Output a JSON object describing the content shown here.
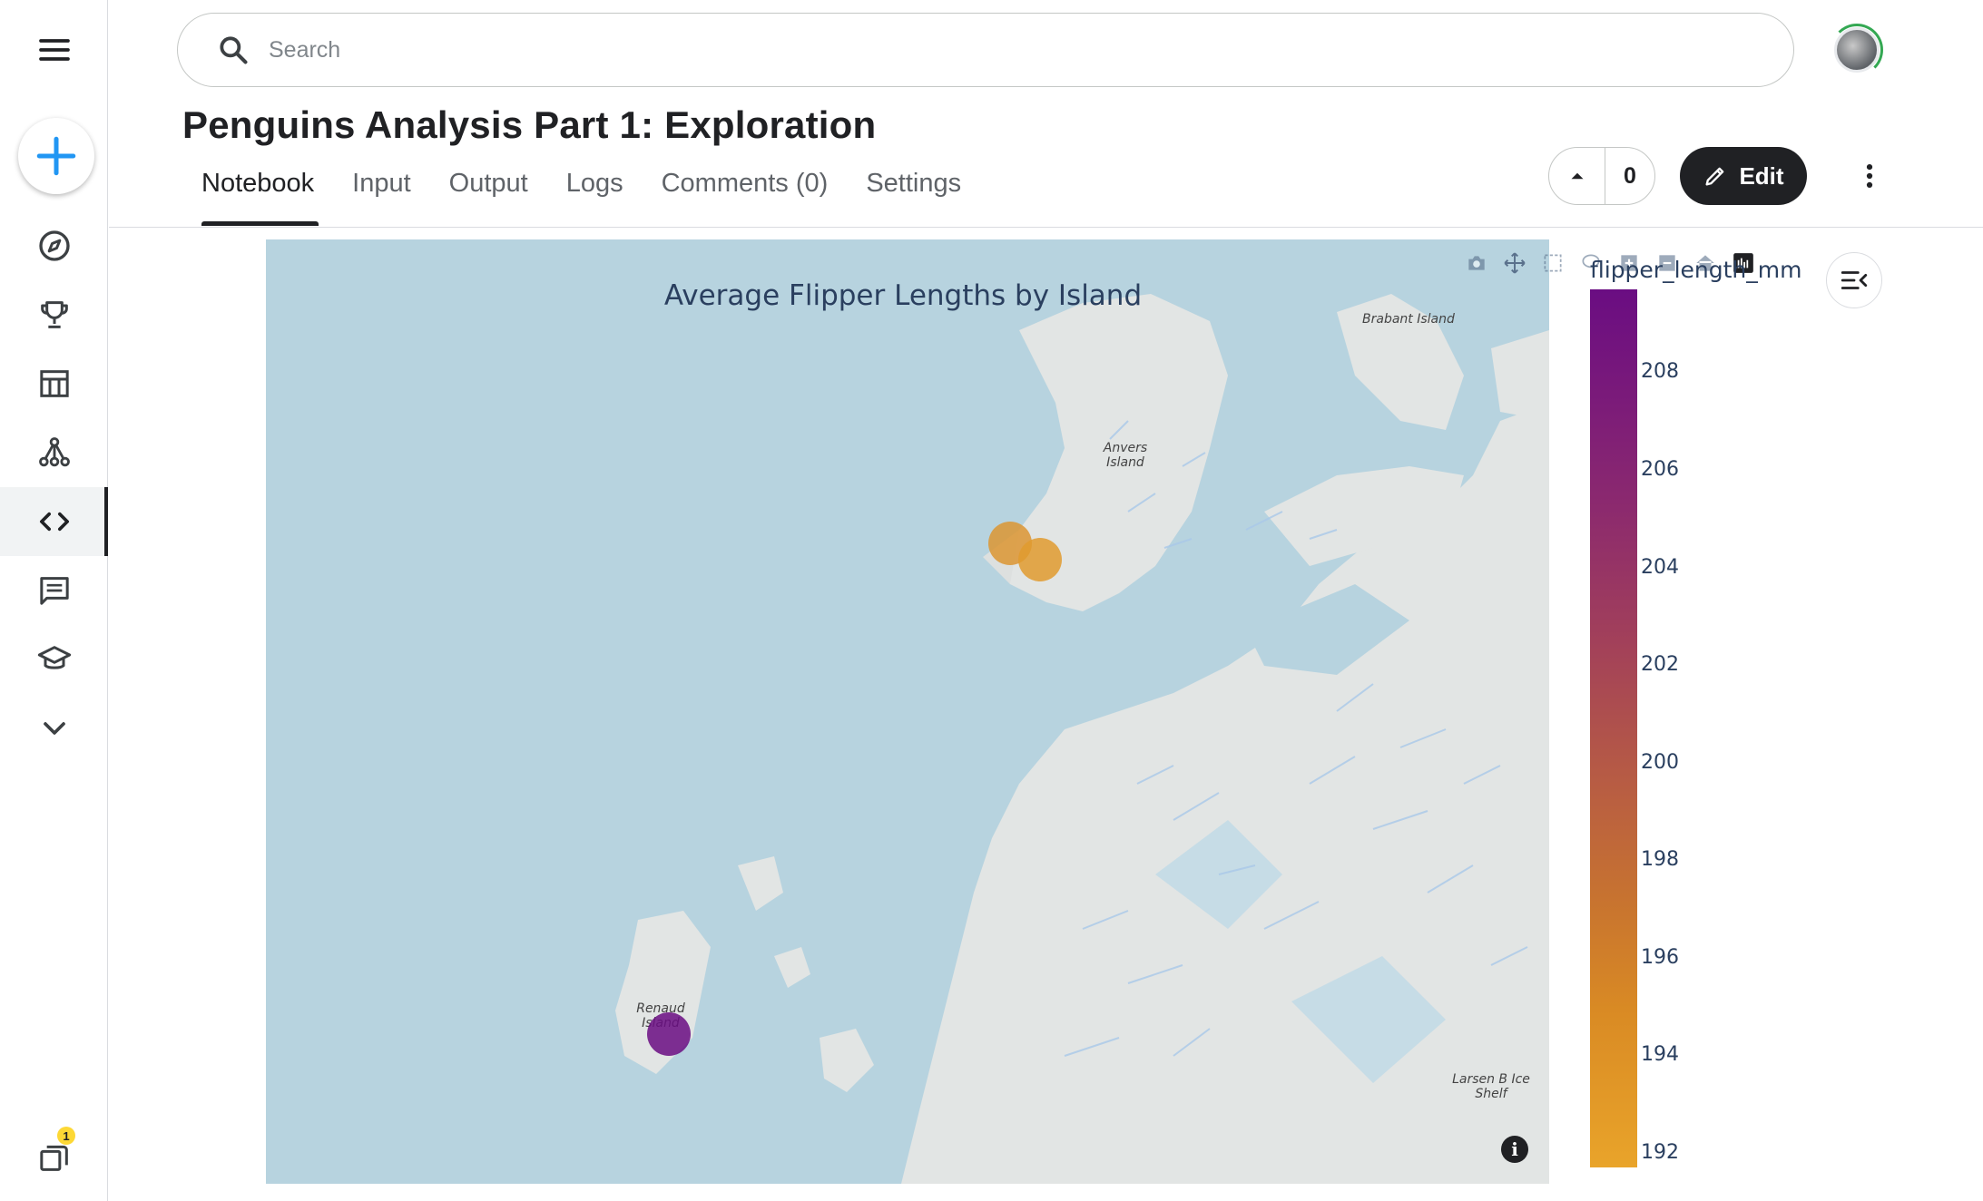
{
  "header": {
    "search_placeholder": "Search",
    "title": "Penguins Analysis Part 1: Exploration",
    "tabs": [
      "Notebook",
      "Input",
      "Output",
      "Logs",
      "Comments (0)",
      "Settings"
    ],
    "active_tab": "Notebook",
    "vote_count": "0",
    "edit_label": "Edit"
  },
  "sidebar": {
    "items": [
      "menu-icon",
      "create-icon",
      "compass-icon",
      "trophy-icon",
      "table-icon",
      "models-icon",
      "code-icon",
      "comments-icon",
      "learn-icon",
      "chevron-down-icon",
      "notifications-icon"
    ],
    "active_item": "code-icon",
    "notification_badge": "1"
  },
  "chart_data": {
    "type": "scatter_map",
    "title": "Average Flipper Lengths by Island",
    "map_labels": [
      "Brabant Island",
      "Anvers Island",
      "Renaud Island",
      "Larsen B Ice Shelf"
    ],
    "colorbar": {
      "title": "flipper_length_mm",
      "ticks": [
        208,
        206,
        204,
        202,
        200,
        198,
        196,
        194,
        192
      ],
      "range": [
        191.7,
        209.7
      ],
      "colors": [
        "#e9a42a",
        "#6a0d82"
      ]
    },
    "points": [
      {
        "location": "Anvers Island (west)",
        "value": 193.5
      },
      {
        "location": "Anvers Island (south-west)",
        "value": 192.8
      },
      {
        "location": "Renaud Island",
        "value": 209.7
      }
    ]
  }
}
